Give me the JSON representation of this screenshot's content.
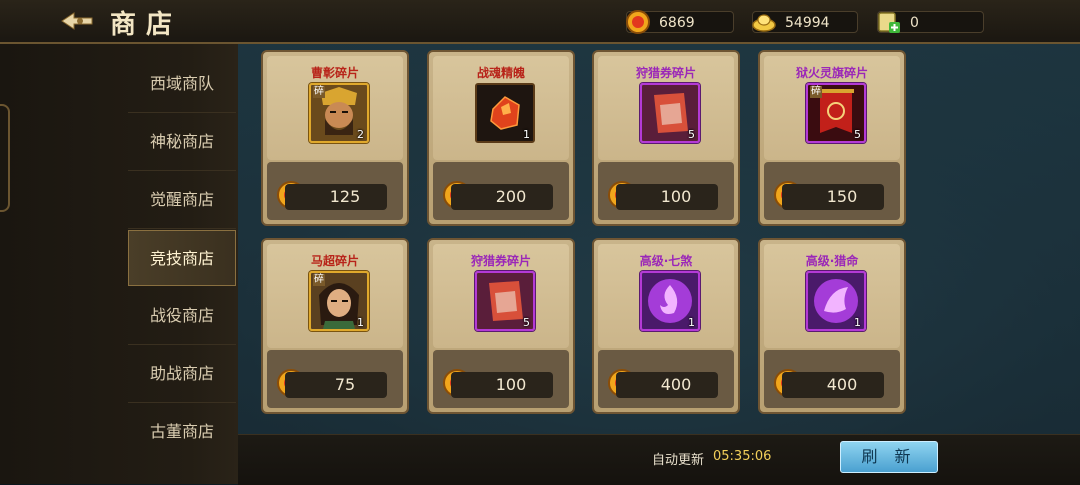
{
  "header": {
    "title": "商店"
  },
  "resources": [
    {
      "icon": "gold-coin-icon",
      "value": "6869"
    },
    {
      "icon": "silver-ingot-icon",
      "value": "54994"
    },
    {
      "icon": "ticket-add-icon",
      "value": "0"
    }
  ],
  "sidebar": {
    "tabs": [
      {
        "label": "西域商队"
      },
      {
        "label": "神秘商店"
      },
      {
        "label": "觉醒商店"
      },
      {
        "label": "竞技商店"
      },
      {
        "label": "战役商店"
      },
      {
        "label": "助战商店"
      },
      {
        "label": "古董商店"
      }
    ],
    "active_index": 3
  },
  "items": [
    {
      "name": "曹彰碎片",
      "qty": "2",
      "price": "125",
      "frag": "碎",
      "icon": "hero-portrait-caozhang-icon",
      "rarity": "gold"
    },
    {
      "name": "战魂精魄",
      "qty": "1",
      "price": "200",
      "icon": "red-crystal-icon",
      "rarity": "plain"
    },
    {
      "name": "狩猎券碎片",
      "qty": "5",
      "price": "100",
      "icon": "hunting-ticket-icon",
      "rarity": "purple"
    },
    {
      "name": "狱火灵旗碎片",
      "qty": "5",
      "price": "150",
      "frag": "碎",
      "icon": "flag-icon",
      "rarity": "purple"
    },
    {
      "name": "马超碎片",
      "qty": "1",
      "price": "75",
      "frag": "碎",
      "icon": "hero-portrait-machao-icon",
      "rarity": "gold"
    },
    {
      "name": "狩猎券碎片",
      "qty": "5",
      "price": "100",
      "icon": "hunting-ticket-icon",
      "rarity": "purple"
    },
    {
      "name": "高级·七煞",
      "qty": "1",
      "price": "400",
      "icon": "purple-flame-icon",
      "rarity": "purple"
    },
    {
      "name": "高级·猎命",
      "qty": "1",
      "price": "400",
      "icon": "purple-spiral-icon",
      "rarity": "purple"
    }
  ],
  "footer": {
    "auto_refresh_label": "自动更新",
    "auto_refresh_time": "05:35:06",
    "refresh_button": "刷 新"
  }
}
